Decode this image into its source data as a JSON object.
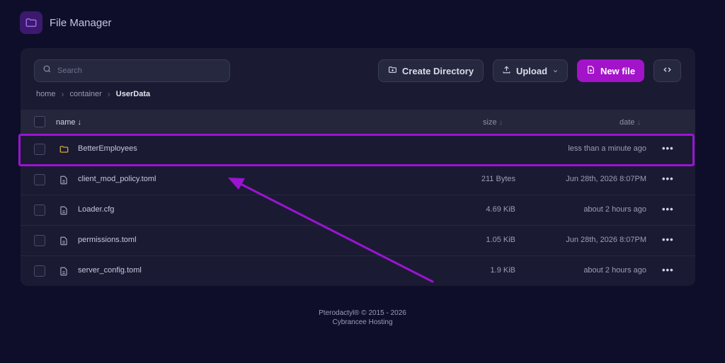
{
  "header": {
    "title": "File Manager",
    "logo_icon": "folder-icon"
  },
  "search": {
    "placeholder": "Search",
    "value": ""
  },
  "toolbar": {
    "create_label": "Create Directory",
    "upload_label": "Upload",
    "new_file_label": "New file",
    "accent": "#a313c9"
  },
  "breadcrumb": {
    "items": [
      "home",
      "container"
    ],
    "current": "UserData"
  },
  "table": {
    "columns": {
      "name": "name",
      "size": "size",
      "date": "date"
    },
    "rows": [
      {
        "name": "BetterEmployees",
        "type": "folder",
        "size": "",
        "date": "less than a minute ago"
      },
      {
        "name": "client_mod_policy.toml",
        "type": "file",
        "size": "211 Bytes",
        "date": "Jun 28th, 2026 8:07PM"
      },
      {
        "name": "Loader.cfg",
        "type": "file",
        "size": "4.69 KiB",
        "date": "about 2 hours ago"
      },
      {
        "name": "permissions.toml",
        "type": "file",
        "size": "1.05 KiB",
        "date": "Jun 28th, 2026 8:07PM"
      },
      {
        "name": "server_config.toml",
        "type": "file",
        "size": "1.9 KiB",
        "date": "about 2 hours ago"
      }
    ]
  },
  "footer": {
    "line1": "Pterodactyl® © 2015 - 2026",
    "line2": "Cybrancee Hosting"
  },
  "annotation": {
    "color": "#9b14d1"
  }
}
